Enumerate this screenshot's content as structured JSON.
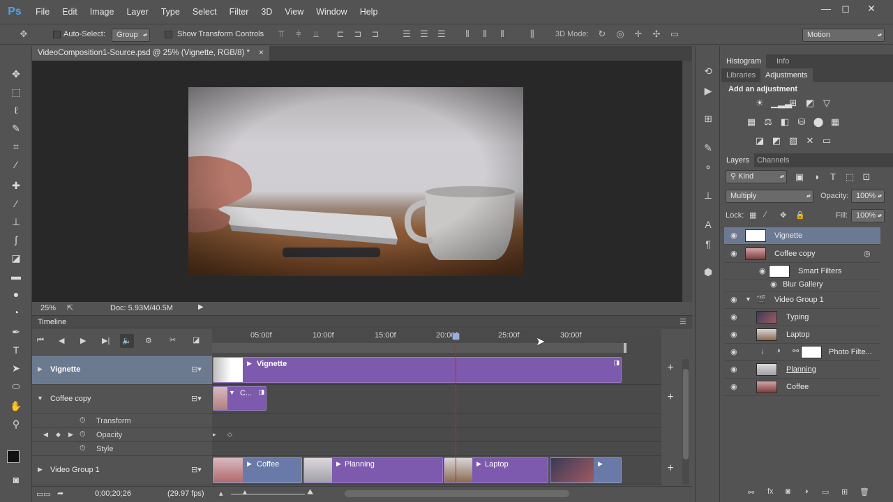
{
  "app": {
    "logo": "Ps"
  },
  "menu": [
    "File",
    "Edit",
    "Image",
    "Layer",
    "Type",
    "Select",
    "Filter",
    "3D",
    "View",
    "Window",
    "Help"
  ],
  "window_controls": {
    "minimize": "—",
    "maximize": "◻",
    "close": "✕"
  },
  "options": {
    "auto_select_label": "Auto-Select:",
    "auto_select_value": "Group",
    "show_transform_label": "Show Transform Controls",
    "mode_3d_label": "3D Mode:",
    "workspace": "Motion"
  },
  "document": {
    "tab_title": "VideoComposition1-Source.psd @ 25% (Vignette, RGB/8) *",
    "tab_close": "×",
    "zoom": "25%",
    "doc_size": "Doc: 5.93M/40.5M"
  },
  "timeline": {
    "panel_title": "Timeline",
    "ruler": [
      "05:00f",
      "10:00f",
      "15:00f",
      "20:00f",
      "25:00f",
      "30:00f"
    ],
    "tracks": [
      {
        "name": "Vignette",
        "clips": [
          "Vignette"
        ]
      },
      {
        "name": "Coffee copy",
        "clips": [
          "C..."
        ]
      },
      {
        "name": "Video Group 1",
        "clips": [
          "Coffee",
          "Planning",
          "Laptop"
        ]
      }
    ],
    "properties": [
      "Transform",
      "Opacity",
      "Style"
    ],
    "timecode": "0;00;20;26",
    "fps": "(29.97 fps)"
  },
  "panels": {
    "top_tabs": [
      "Histogram",
      "Info"
    ],
    "mid_tabs": [
      "Libraries",
      "Adjustments"
    ],
    "adjust_title": "Add an adjustment",
    "layers_tabs": [
      "Layers",
      "Channels"
    ],
    "kind": "Kind",
    "blend": "Multiply",
    "opacity_label": "Opacity:",
    "opacity": "100%",
    "lock_label": "Lock:",
    "fill_label": "Fill:",
    "fill": "100%",
    "layers": [
      {
        "name": "Vignette"
      },
      {
        "name": "Coffee copy"
      },
      {
        "name": "Smart Filters"
      },
      {
        "name": "Blur Gallery"
      },
      {
        "name": "Video Group 1"
      },
      {
        "name": "Typing"
      },
      {
        "name": "Laptop"
      },
      {
        "name": "Photo Filte..."
      },
      {
        "name": "Planning"
      },
      {
        "name": "Coffee"
      }
    ]
  },
  "colors": {
    "clip": "#7e5aae",
    "playhead": "#c0282c",
    "accent": "#4aa3f0",
    "selected_layer": "#6b7a92"
  }
}
